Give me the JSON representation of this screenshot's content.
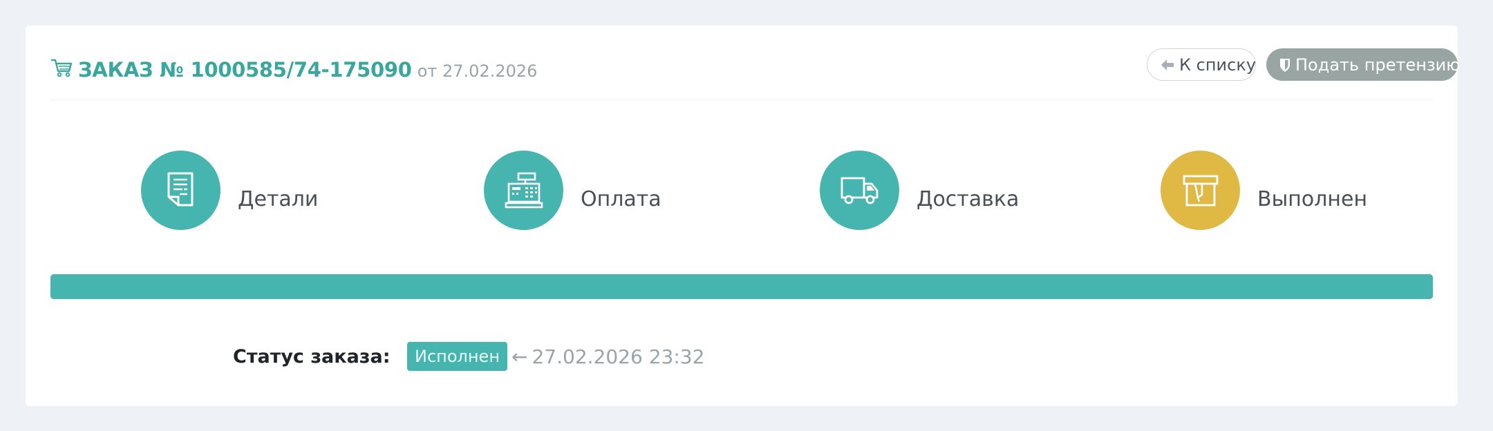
{
  "order": {
    "title": "ЗАКАЗ № 1000585/74-175090",
    "date_text": "от 27.02.2026",
    "title_color": "#3aa79e",
    "icon": "shopping-cart-icon"
  },
  "actions": {
    "back_label": "К списку",
    "back_icon": "arrow-left-icon",
    "claim_label": "Подать претензию",
    "claim_icon": "shield-icon"
  },
  "steps": [
    {
      "label": "Детали",
      "icon": "document-icon",
      "color": "#46b5af"
    },
    {
      "label": "Оплата",
      "icon": "cash-register-icon",
      "color": "#46b5af"
    },
    {
      "label": "Доставка",
      "icon": "truck-icon",
      "color": "#46b5af"
    },
    {
      "label": "Выполнен",
      "icon": "package-icon",
      "color": "#e0b945"
    }
  ],
  "progress": {
    "percent": 100,
    "color": "#46b5af"
  },
  "status": {
    "label": "Статус заказа:",
    "badge": "Исполнен",
    "arrow": "←",
    "timestamp": "27.02.2026 23:32"
  }
}
